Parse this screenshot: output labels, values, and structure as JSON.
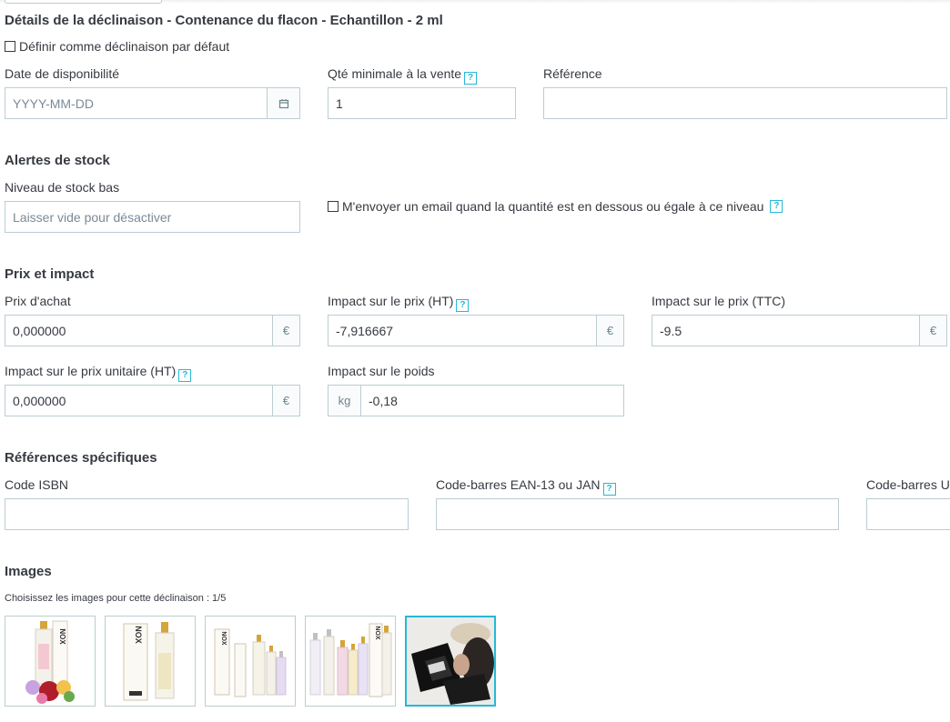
{
  "page": {
    "title": "Détails de la déclinaison - Contenance du flacon - Echantillon - 2 ml",
    "default_checkbox_label": "Définir comme déclinaison par défaut"
  },
  "availability": {
    "date_label": "Date de disponibilité",
    "date_placeholder": "YYYY-MM-DD",
    "min_qty_label": "Qté minimale à la vente",
    "min_qty_value": "1",
    "reference_label": "Référence",
    "reference_value": ""
  },
  "stock_alerts": {
    "title": "Alertes de stock",
    "low_stock_label": "Niveau de stock bas",
    "low_stock_placeholder": "Laisser vide pour désactiver",
    "email_checkbox_label": "M'envoyer un email quand la quantité est en dessous ou égale à ce niveau"
  },
  "price": {
    "title": "Prix et impact",
    "purchase_label": "Prix d'achat",
    "purchase_value": "0,000000",
    "impact_ht_label": "Impact sur le prix (HT)",
    "impact_ht_value": "-7,916667",
    "impact_ttc_label": "Impact sur le prix (TTC)",
    "impact_ttc_value": "-9.5",
    "unit_price_label": "Impact sur le prix unitaire (HT)",
    "unit_price_value": "0,000000",
    "weight_label": "Impact sur le poids",
    "weight_unit": "kg",
    "weight_value": "-0,18",
    "currency": "€",
    "help": "?"
  },
  "references": {
    "title": "Références spécifiques",
    "isbn_label": "Code ISBN",
    "isbn_value": "",
    "ean_label": "Code-barres EAN-13 ou JAN",
    "ean_value": "",
    "upc_label": "Code-barres U",
    "upc_value": ""
  },
  "images": {
    "title": "Images",
    "choose_label": "Choisissez les images pour cette déclinaison : 1/5",
    "brand_text": "NOX"
  },
  "colors": {
    "accent": "#25b9d7",
    "border": "#bbcdd2",
    "text": "#363a41"
  }
}
